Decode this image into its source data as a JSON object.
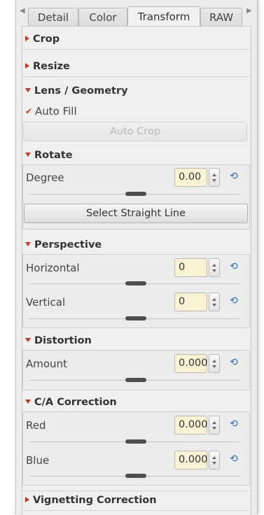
{
  "tabs": [
    "Detail",
    "Color",
    "Transform",
    "RAW"
  ],
  "active_tab": "Transform",
  "sections": {
    "crop": "Crop",
    "resize": "Resize",
    "lens": "Lens / Geometry",
    "vignetting": "Vignetting Correction"
  },
  "auto_fill": {
    "label": "Auto Fill",
    "checked": true
  },
  "auto_crop_label": "Auto Crop",
  "rotate": {
    "title": "Rotate",
    "degree_label": "Degree",
    "degree_value": "0.00",
    "straight_line_label": "Select Straight Line"
  },
  "perspective": {
    "title": "Perspective",
    "horizontal_label": "Horizontal",
    "horizontal_value": "0",
    "vertical_label": "Vertical",
    "vertical_value": "0"
  },
  "distortion": {
    "title": "Distortion",
    "amount_label": "Amount",
    "amount_value": "0.000"
  },
  "ca": {
    "title": "C/A Correction",
    "red_label": "Red",
    "red_value": "0.000",
    "blue_label": "Blue",
    "blue_value": "0.000"
  },
  "icons": {
    "reset": "reset-icon",
    "expand": "triangle-right-icon",
    "collapse": "triangle-down-icon"
  },
  "colors": {
    "accent": "#c0392b",
    "reset_icon": "#2e6fb8",
    "spin_bg": "#fbf2d4"
  }
}
